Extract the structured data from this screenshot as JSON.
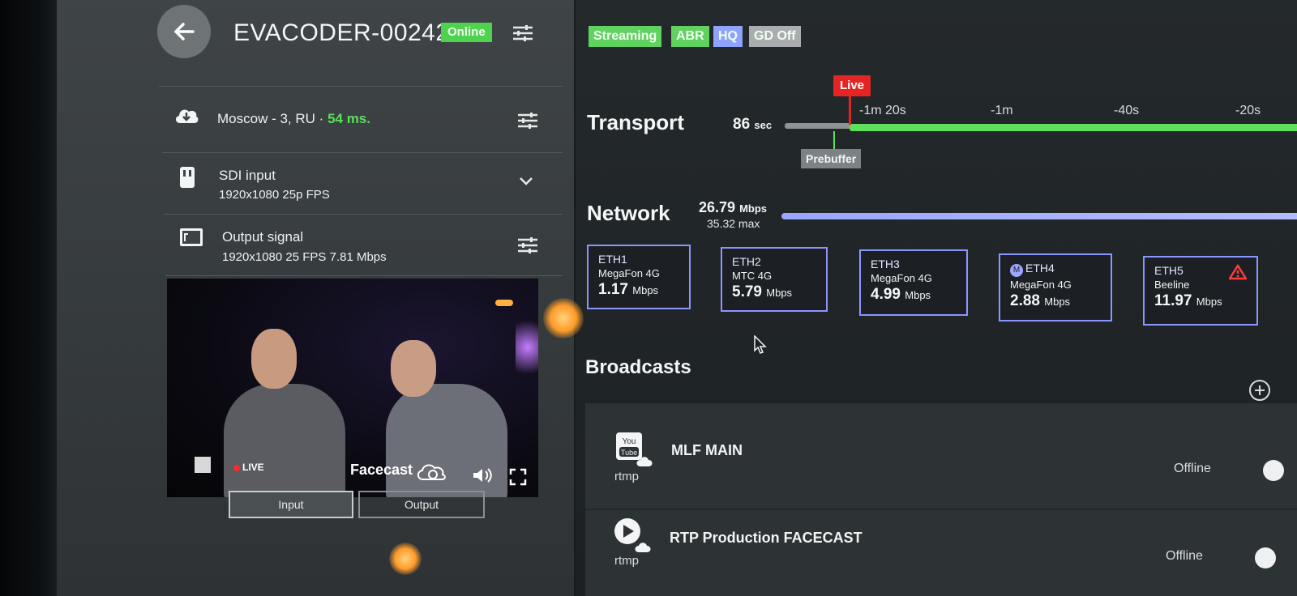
{
  "header": {
    "device_name": "EVACODER-00242",
    "online_label": "Online"
  },
  "rows": {
    "server_label": "Moscow - 3, RU",
    "server_sep": "·",
    "server_latency": "54 ms.",
    "input_title": "SDI input",
    "input_sub": "1920x1080 25p FPS",
    "output_title": "Output signal",
    "output_sub": "1920x1080 25 FPS 7.81 Mbps"
  },
  "preview": {
    "live_label": "LIVE",
    "brand": "Facecast",
    "tab_input": "Input",
    "tab_output": "Output"
  },
  "status_badges": [
    {
      "label": "Streaming",
      "color": "#5fd25f"
    },
    {
      "label": "ABR",
      "color": "#5fd25f"
    },
    {
      "label": "HQ",
      "color": "#8fa3ff"
    },
    {
      "label": "GD Off",
      "color": "#a9adaf"
    }
  ],
  "transport": {
    "title": "Transport",
    "seconds": "86",
    "seconds_unit": "sec",
    "live_label": "Live",
    "ticks": [
      "-1m 20s",
      "-1m",
      "-40s",
      "-20s"
    ],
    "prebuffer_label": "Prebuffer"
  },
  "network": {
    "title": "Network",
    "rate": "26.79",
    "rate_unit": "Mbps",
    "max": "35.32 max",
    "interfaces": [
      {
        "name": "ETH1",
        "carrier": "MegaFon 4G",
        "rate": "1.17",
        "unit": "Mbps"
      },
      {
        "name": "ETH2",
        "carrier": "MTC 4G",
        "rate": "5.79",
        "unit": "Mbps"
      },
      {
        "name": "ETH3",
        "carrier": "MegaFon 4G",
        "rate": "4.99",
        "unit": "Mbps"
      },
      {
        "name": "ETH4",
        "carrier": "MegaFon 4G",
        "rate": "2.88",
        "unit": "Mbps",
        "badge": "M"
      },
      {
        "name": "ETH5",
        "carrier": "Beeline",
        "rate": "11.97",
        "unit": "Mbps",
        "warning": true
      }
    ]
  },
  "broadcasts": {
    "title": "Broadcasts",
    "items": [
      {
        "name": "MLF MAIN",
        "protocol": "rtmp",
        "status": "Offline",
        "icon": "youtube-icon"
      },
      {
        "name": "RTP Production FACECAST",
        "protocol": "rtmp",
        "status": "Offline",
        "icon": "play-icon"
      }
    ]
  },
  "icons": {
    "back": "arrow-left-icon",
    "tune": "sliders-icon",
    "cloud": "cloud-download-icon",
    "sdi": "sdi-port-icon",
    "output": "display-icon",
    "chevron": "chevron-down-icon",
    "warning": "warning-triangle-icon",
    "add": "plus-circle-icon"
  }
}
